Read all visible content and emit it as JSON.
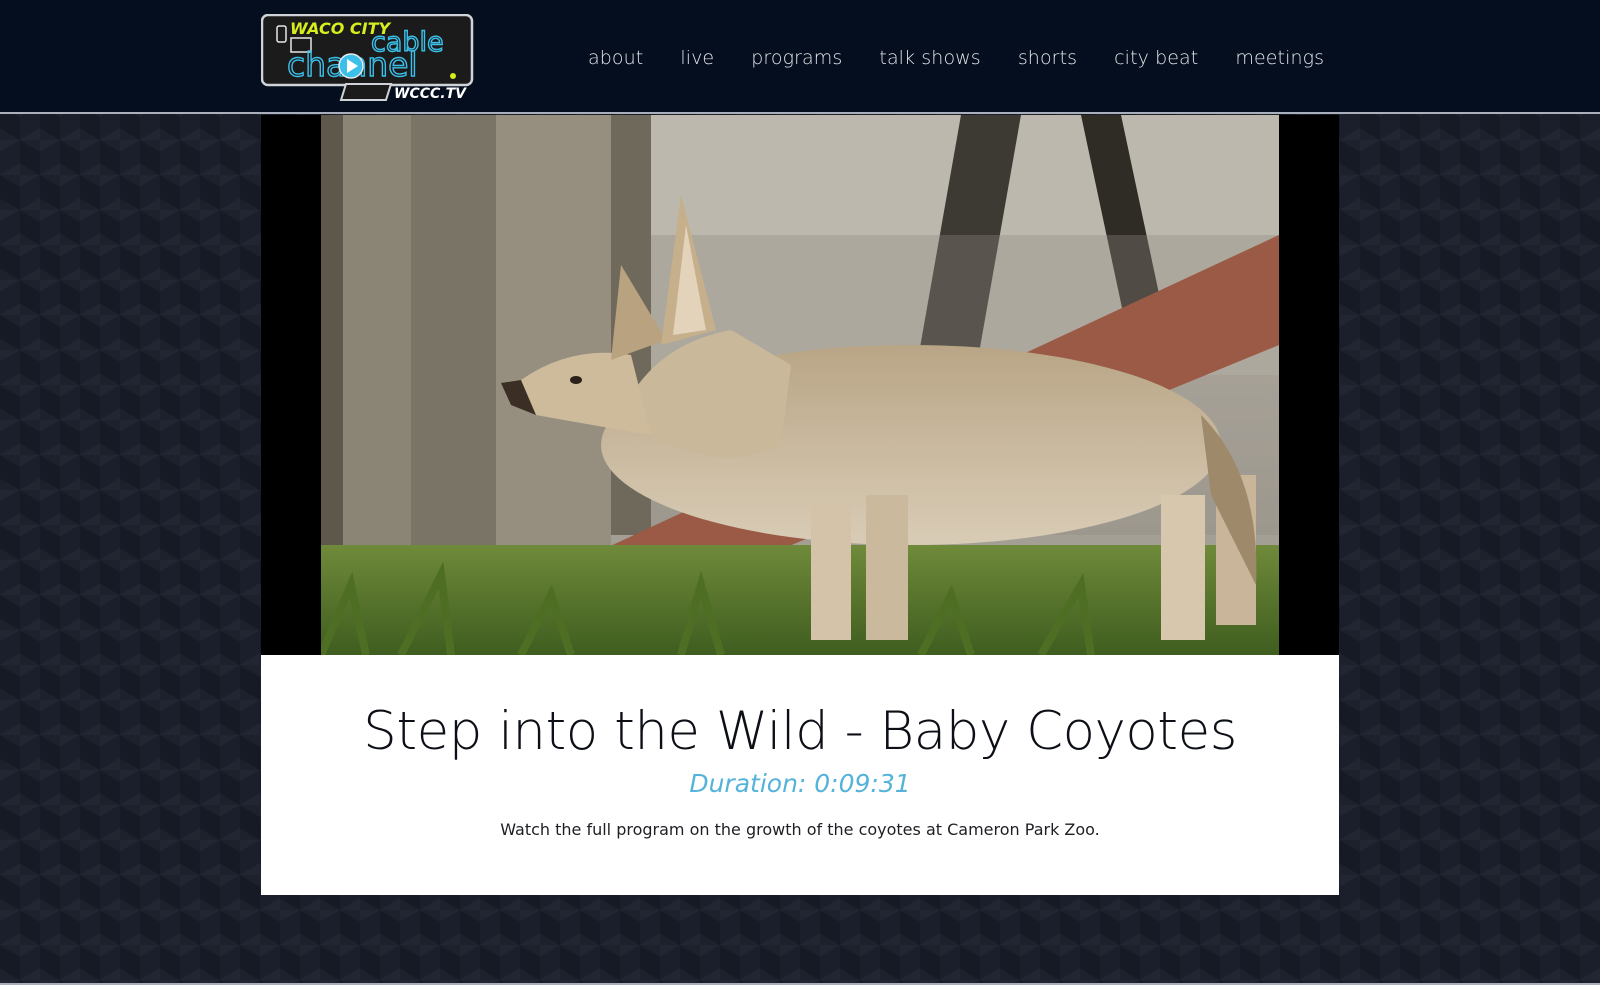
{
  "header": {
    "logo": {
      "line1": "WACO CITY",
      "line2": "cable",
      "line3": "channel",
      "line4": "WCCC.TV"
    },
    "nav": [
      {
        "label": "about"
      },
      {
        "label": "live"
      },
      {
        "label": "programs"
      },
      {
        "label": "talk shows"
      },
      {
        "label": "shorts"
      },
      {
        "label": "city beat"
      },
      {
        "label": "meetings"
      }
    ]
  },
  "video": {
    "title": "Step into the Wild - Baby Coyotes",
    "duration": "Duration: 0:09:31",
    "description": "Watch the full program on the growth of the coyotes at Cameron Park Zoo."
  },
  "colors": {
    "header_bg": "#050e1f",
    "page_bg": "#1a1f2b",
    "duration_accent": "#55b3da",
    "logo_yellow": "#d6ef1c",
    "logo_cyan": "#3bc0ea"
  }
}
